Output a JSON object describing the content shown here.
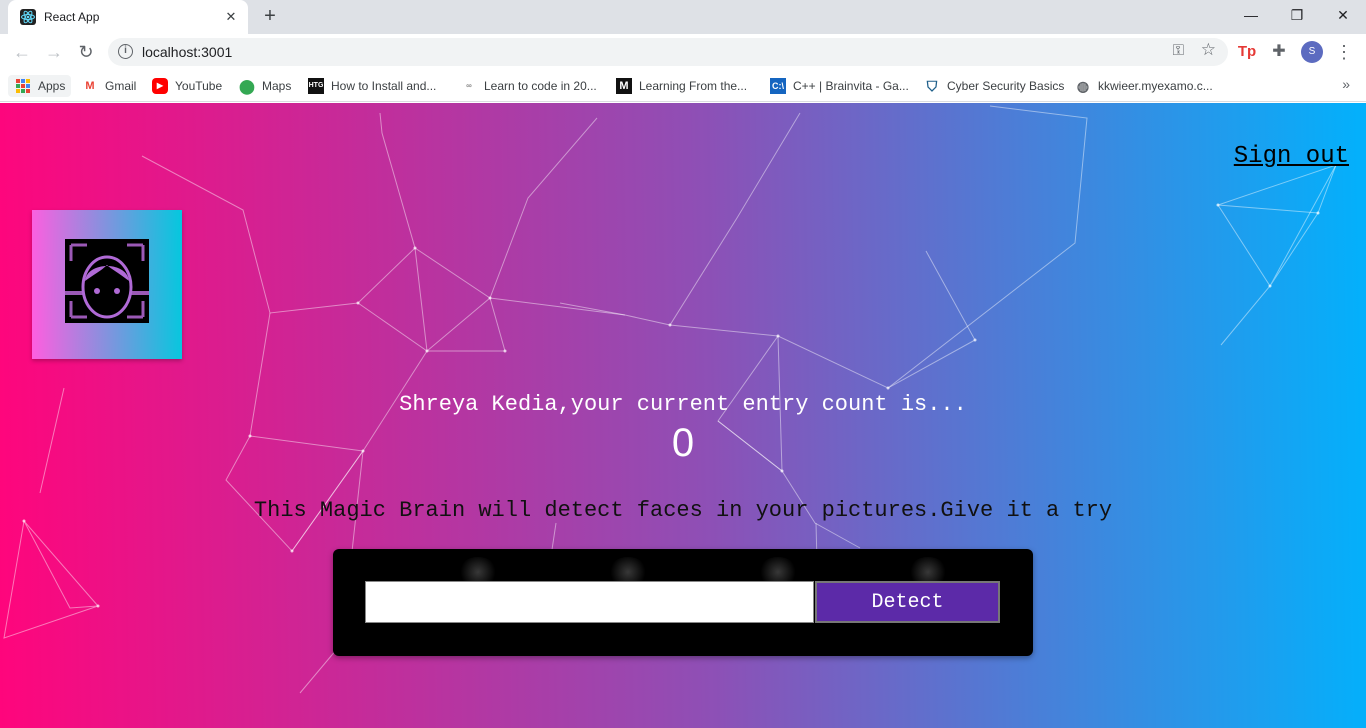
{
  "browser": {
    "tab_title": "React App",
    "tab_close": "✕",
    "new_tab": "+",
    "window_controls": [
      "—",
      "❐",
      "✕"
    ],
    "url": "localhost:3001",
    "profile_initial": "S",
    "bookmarks": [
      {
        "label": "Apps",
        "icon": "apps-grid-icon"
      },
      {
        "label": "Gmail",
        "icon": "gmail-icon"
      },
      {
        "label": "YouTube",
        "icon": "youtube-icon"
      },
      {
        "label": "Maps",
        "icon": "maps-icon"
      },
      {
        "label": "How to Install and...",
        "icon": "htg-icon"
      },
      {
        "label": "Learn to code in 20...",
        "icon": "code-icon"
      },
      {
        "label": "Learning From the...",
        "icon": "medium-icon"
      },
      {
        "label": "C++ | Brainvita - Ga...",
        "icon": "cpp-icon"
      },
      {
        "label": "Cyber Security Basics",
        "icon": "shield-icon"
      },
      {
        "label": "kkwieer.myexamo.c...",
        "icon": "globe-icon"
      }
    ]
  },
  "page": {
    "signout_label": "Sign out",
    "rank_text": "Shreya Kedia,your current entry count is...",
    "entry_count": "0",
    "tagline": "This Magic Brain will detect faces in your pictures.Give it a try",
    "image_url_value": "",
    "detect_label": "Detect"
  },
  "colors": {
    "gradient_start": "#ff057c",
    "gradient_mid": "#8d50b6",
    "gradient_end": "#02b1fc",
    "detect_button": "#5c2aa8"
  }
}
